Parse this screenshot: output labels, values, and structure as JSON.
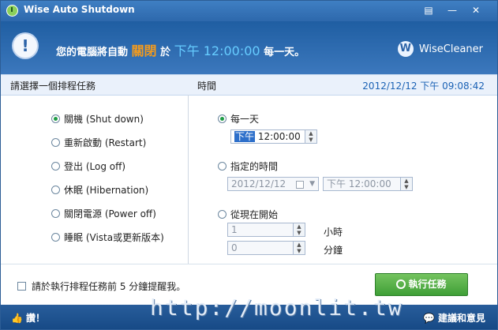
{
  "window": {
    "title": "Wise Auto Shutdown",
    "controls": [
      "▤",
      "—",
      "✕"
    ]
  },
  "header": {
    "message_prefix": "您的電腦將自動",
    "action": "關閉",
    "preposition": "於",
    "time": "下午 12:00:00",
    "suffix": "每一天。",
    "brand": "WiseCleaner"
  },
  "section": {
    "left_title": "請選擇一個排程任務",
    "right_title": "時間",
    "datetime": "2012/12/12 下午 09:08:42"
  },
  "tasks": [
    {
      "label": "關機 (Shut down)",
      "checked": true
    },
    {
      "label": "重新啟動 (Restart)",
      "checked": false
    },
    {
      "label": "登出 (Log off)",
      "checked": false
    },
    {
      "label": "休眠 (Hibernation)",
      "checked": false
    },
    {
      "label": "關閉電源 (Power off)",
      "checked": false
    },
    {
      "label": "睡眠 (Vista或更新版本)",
      "checked": false
    }
  ],
  "schedule": {
    "daily_label": "每一天",
    "daily_time_selected": "下午",
    "daily_time_rest": " 12:00:00",
    "specified_label": "指定的時間",
    "specified_date": "2012/12/12",
    "specified_time": "下午 12:00:00",
    "from_now_label": "從現在開始",
    "hours_value": "1",
    "hours_unit": "小時",
    "minutes_value": "0",
    "minutes_unit": "分鐘"
  },
  "footer": {
    "reminder_label": "請於執行排程任務前 5 分鐘提醒我。",
    "run_button": "執行任務",
    "like": "讚！",
    "watermark": "http://moonlit.tw",
    "feedback": "建議和意見"
  },
  "icons": {
    "app": "app-power-icon",
    "info": "info-icon",
    "brand": "wisecleaner-logo-icon",
    "calendar": "calendar-icon",
    "alarm": "alarm-clock-icon",
    "thumb": "thumbs-up-icon",
    "feedback": "speech-bubble-icon"
  },
  "colors": {
    "accent": "#2d6fca",
    "header": "#1f5ea2",
    "highlight": "#f29b1f",
    "time_text": "#66ccff",
    "run_button": "#4caf40"
  }
}
